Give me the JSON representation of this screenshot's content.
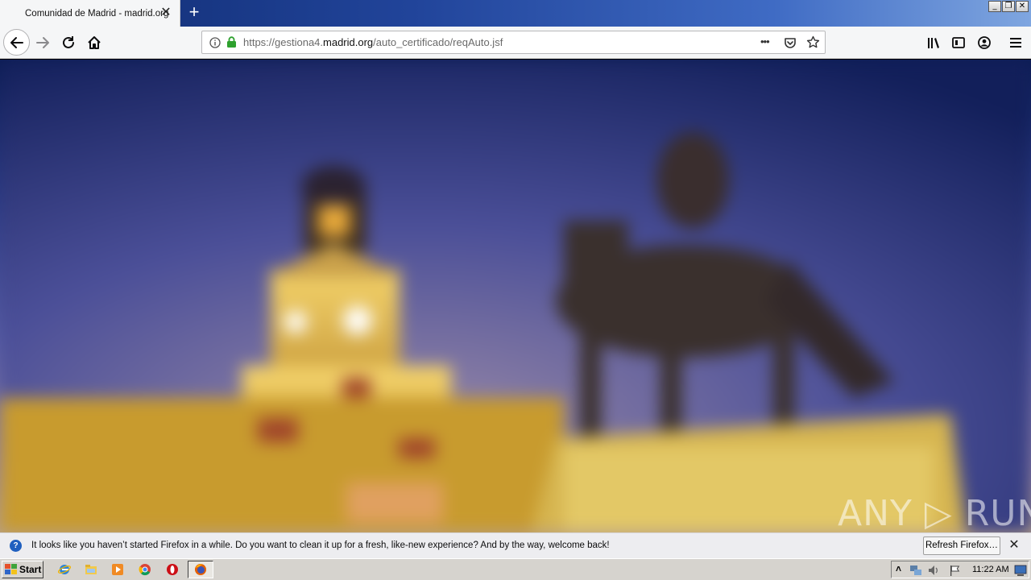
{
  "browser": {
    "tab_title": "Comunidad de Madrid - madrid.org",
    "new_tab_symbol": "+",
    "close_symbol": "✕",
    "url_prefix": "https://gestiona4.",
    "url_host": "madrid.org",
    "url_path": "/auto_certificado/reqAuto.jsf",
    "page_actions_symbol": "•••"
  },
  "window_controls": {
    "minimize": "_",
    "restore": "❐",
    "close": "✕"
  },
  "notification": {
    "message": "It looks like you haven’t started Firefox in a while. Do you want to clean it up for a fresh, like-new experience? And by the way, welcome back!",
    "button_label": "Refresh Firefox…",
    "close_symbol": "✕",
    "info_symbol": "?"
  },
  "watermark": "ANY ▷ RUN",
  "taskbar": {
    "start_label": "Start",
    "clock": "11:22 AM",
    "tray_arrow": "˄"
  },
  "colors": {
    "accent": "#1f5fbf",
    "secure_lock": "#2ea12e",
    "titlebar_start": "#0f2a6e",
    "titlebar_end": "#7fa6e0"
  },
  "icons": [
    "back-arrow-icon",
    "forward-arrow-icon",
    "reload-icon",
    "home-icon",
    "info-icon",
    "lock-icon",
    "pocket-icon",
    "bookmark-star-icon",
    "library-icon",
    "sidebar-icon",
    "account-icon",
    "menu-icon",
    "ie-icon",
    "explorer-icon",
    "media-player-icon",
    "chrome-icon",
    "opera-icon",
    "firefox-icon",
    "network-icon",
    "volume-icon",
    "flag-icon",
    "desktop-icon"
  ]
}
